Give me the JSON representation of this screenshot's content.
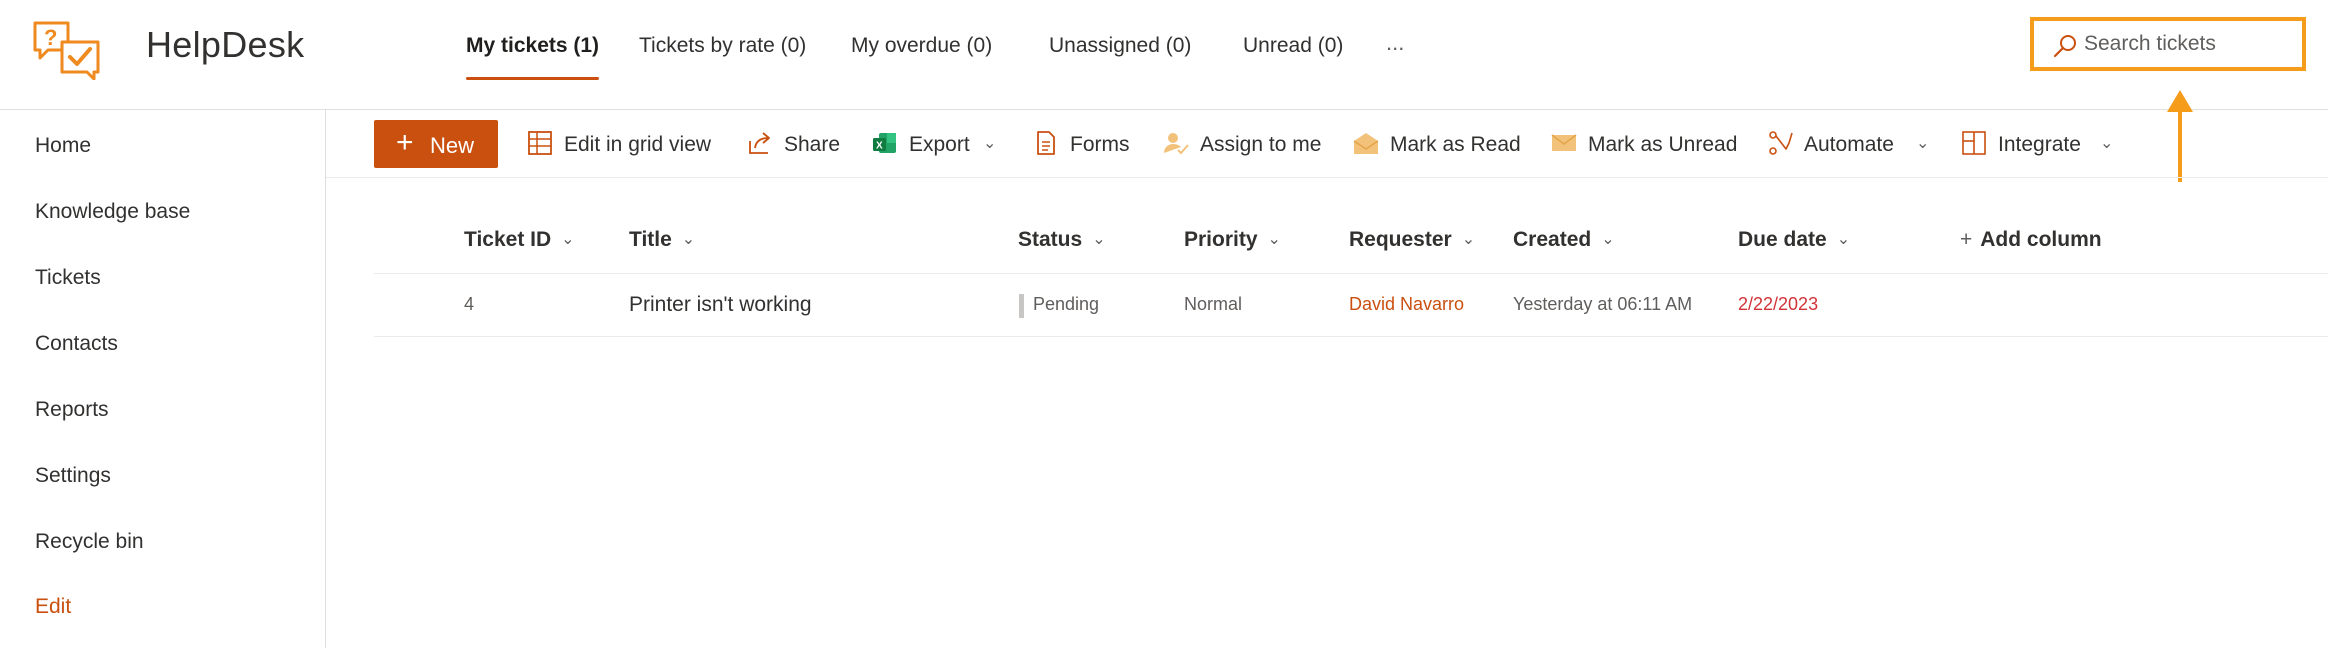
{
  "app": {
    "title": "HelpDesk",
    "logo_icon": "helpdesk-logo-icon"
  },
  "tabs": [
    {
      "label": "My tickets (1)",
      "active": true
    },
    {
      "label": "Tickets by rate (0)",
      "active": false
    },
    {
      "label": "My overdue (0)",
      "active": false
    },
    {
      "label": "Unassigned (0)",
      "active": false
    },
    {
      "label": "Unread (0)",
      "active": false
    }
  ],
  "tabs_more": "...",
  "search": {
    "placeholder": "Search tickets",
    "value": "",
    "icon": "search-icon",
    "highlight_color": "#f59c1a"
  },
  "sidebar": {
    "items": [
      {
        "label": "Home"
      },
      {
        "label": "Knowledge base"
      },
      {
        "label": "Tickets"
      },
      {
        "label": "Contacts"
      },
      {
        "label": "Reports"
      },
      {
        "label": "Settings"
      },
      {
        "label": "Recycle bin"
      },
      {
        "label": "Edit"
      }
    ]
  },
  "toolbar": {
    "new_label": "New",
    "edit_grid_label": "Edit in grid view",
    "share_label": "Share",
    "export_label": "Export",
    "forms_label": "Forms",
    "assign_label": "Assign to me",
    "mark_read_label": "Mark as Read",
    "mark_unread_label": "Mark as Unread",
    "automate_label": "Automate",
    "integrate_label": "Integrate"
  },
  "table": {
    "columns": [
      "Ticket ID",
      "Title",
      "Status",
      "Priority",
      "Requester",
      "Created",
      "Due date"
    ],
    "add_column_label": "Add column",
    "rows": [
      {
        "ticket_id": "4",
        "title": "Printer isn't working",
        "status": "Pending",
        "priority": "Normal",
        "requester": "David Navarro",
        "created": "Yesterday at 06:11 AM",
        "due_date": "2/22/2023"
      }
    ]
  },
  "colors": {
    "accent": "#ca5010",
    "search_highlight": "#f59c1a",
    "due_date": "#d13438"
  }
}
